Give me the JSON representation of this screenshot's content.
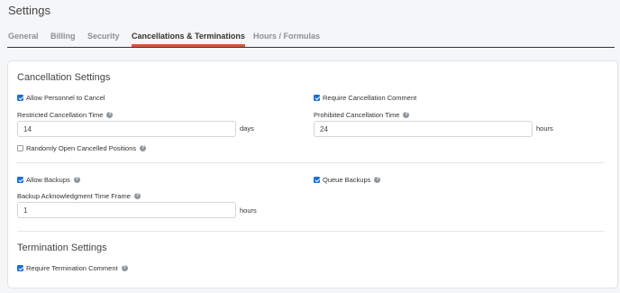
{
  "page": {
    "title": "Settings"
  },
  "tabs": [
    {
      "label": "General",
      "active": false
    },
    {
      "label": "Billing",
      "active": false
    },
    {
      "label": "Security",
      "active": false
    },
    {
      "label": "Cancellations & Terminations",
      "active": true
    },
    {
      "label": "Hours / Formulas",
      "active": false
    }
  ],
  "colors": {
    "accent": "#d9573b",
    "checkbox": "#1c6fd1"
  },
  "cancellation": {
    "title": "Cancellation Settings",
    "allow_personnel_cancel": {
      "label": "Allow Personnel to Cancel",
      "checked": true
    },
    "require_cancel_comment": {
      "label": "Require Cancellation Comment",
      "checked": true
    },
    "restricted_time": {
      "label": "Restricted Cancellation Time",
      "value": "14",
      "unit": "days"
    },
    "prohibited_time": {
      "label": "Prohibited Cancellation Time",
      "value": "24",
      "unit": "hours"
    },
    "random_open": {
      "label": "Randomly Open Cancelled Positions",
      "checked": false
    },
    "allow_backups": {
      "label": "Allow Backups",
      "checked": true
    },
    "queue_backups": {
      "label": "Queue Backups",
      "checked": true
    },
    "backup_ack": {
      "label": "Backup Acknowledgment Time Frame",
      "value": "1",
      "unit": "hours"
    }
  },
  "termination": {
    "title": "Termination Settings",
    "require_comment": {
      "label": "Require Termination Comment",
      "checked": true
    }
  },
  "icons": {
    "help": "question-circle-icon",
    "help_glyph": "?"
  }
}
